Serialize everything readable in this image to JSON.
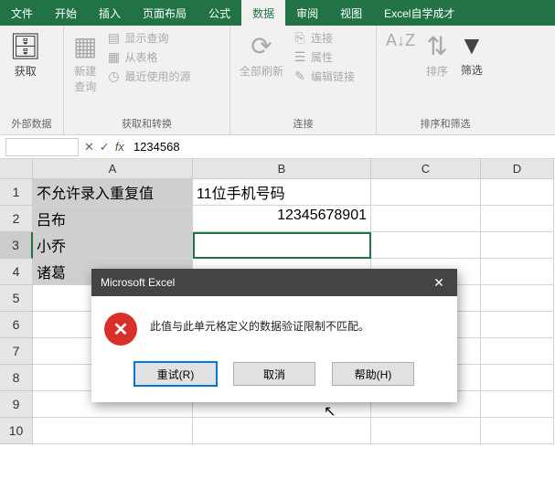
{
  "tabs": {
    "file": "文件",
    "home": "开始",
    "insert": "插入",
    "layout": "页面布局",
    "formula": "公式",
    "data": "数据",
    "review": "审阅",
    "view": "视图",
    "self": "Excel自学成才"
  },
  "ribbon": {
    "g1": {
      "label": "外部数据",
      "btn": "获取"
    },
    "g2": {
      "label": "获取和转换",
      "btn": "新建\n查询",
      "s1": "显示查询",
      "s2": "从表格",
      "s3": "最近使用的源"
    },
    "g3": {
      "label": "连接",
      "btn": "全部刷新",
      "s1": "连接",
      "s2": "属性",
      "s3": "编辑链接"
    },
    "g4": {
      "label": "排序和筛选",
      "b1": "排序",
      "b2": "筛选"
    }
  },
  "formula_bar": {
    "name": "",
    "value": "1234568"
  },
  "grid": {
    "cols": [
      "A",
      "B",
      "C",
      "D"
    ],
    "rows": [
      "1",
      "2",
      "3",
      "4",
      "5",
      "6",
      "7",
      "8",
      "9",
      "10"
    ],
    "A1": "不允许录入重复值",
    "B1": "11位手机号码",
    "A2": "吕布",
    "B2": "12345678901",
    "A3": "小乔",
    "A4": "诸葛"
  },
  "dialog": {
    "title": "Microsoft Excel",
    "msg": "此值与此单元格定义的数据验证限制不匹配。",
    "retry": "重试(R)",
    "cancel": "取消",
    "help": "帮助(H)"
  }
}
